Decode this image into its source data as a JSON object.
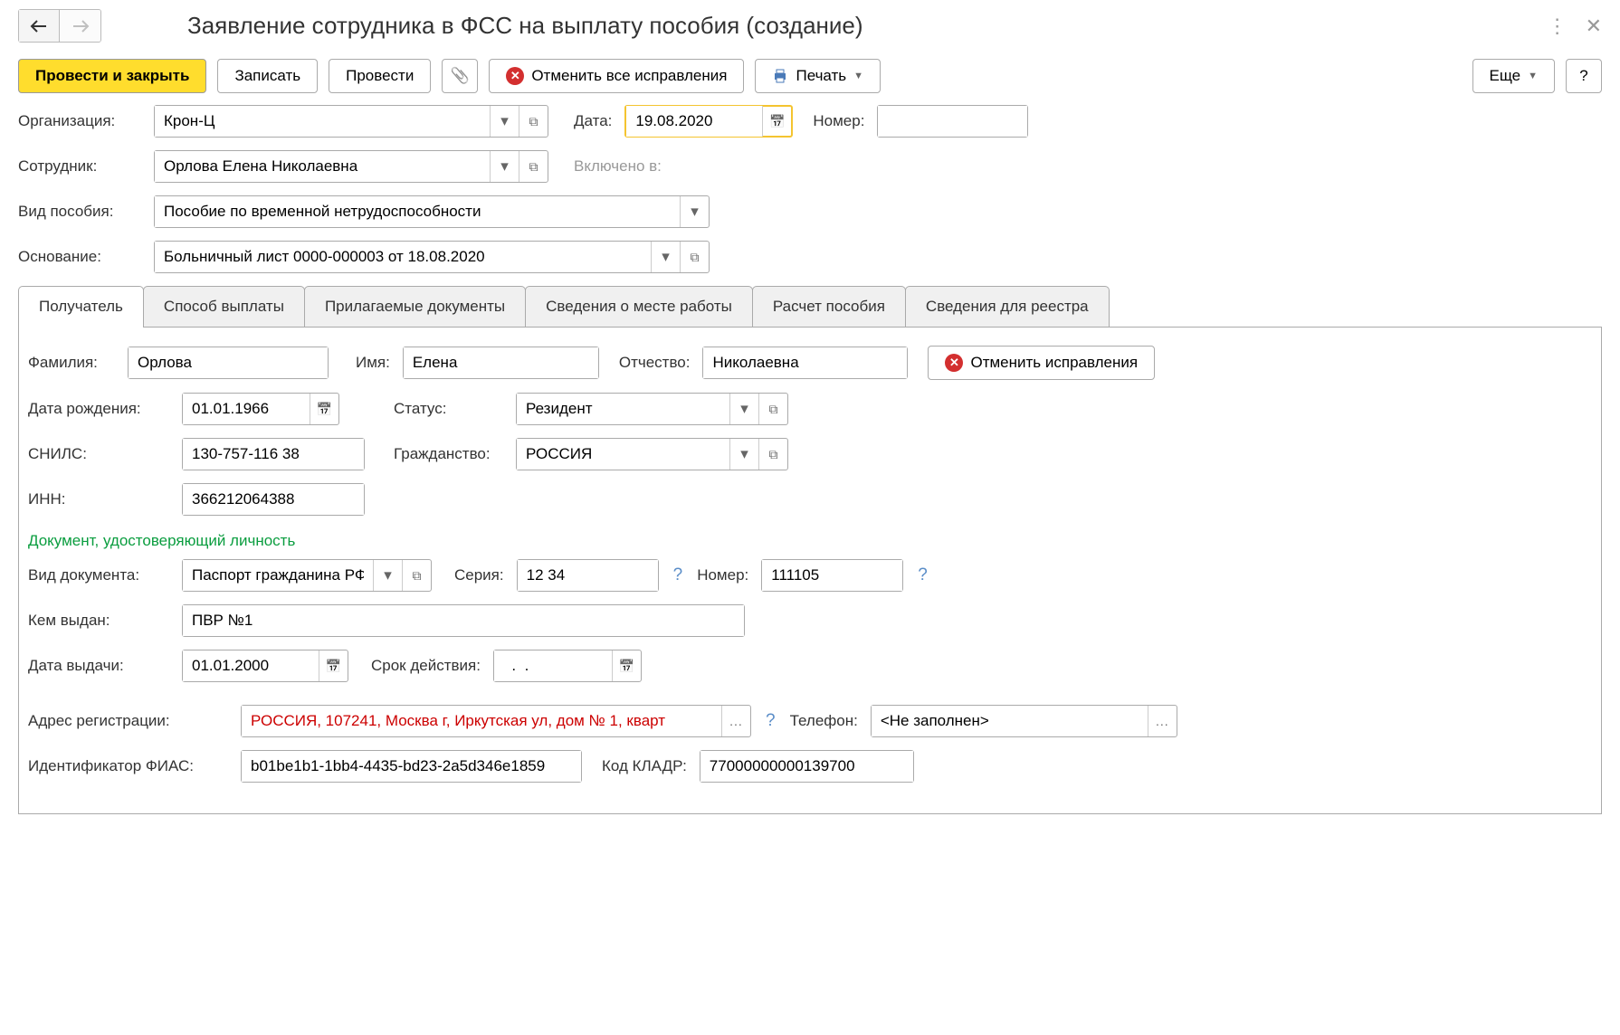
{
  "header": {
    "title": "Заявление сотрудника в ФСС на выплату пособия (создание)"
  },
  "toolbar": {
    "post_close": "Провести и закрыть",
    "save": "Записать",
    "post": "Провести",
    "cancel_all": "Отменить все исправления",
    "print": "Печать",
    "more": "Еще",
    "help": "?"
  },
  "main": {
    "org_label": "Организация:",
    "org_value": "Крон-Ц",
    "date_label": "Дата:",
    "date_value": "19.08.2020",
    "number_label": "Номер:",
    "number_value": "",
    "employee_label": "Сотрудник:",
    "employee_value": "Орлова Елена Николаевна",
    "included_label": "Включено в:",
    "benefit_type_label": "Вид пособия:",
    "benefit_type_value": "Пособие по временной нетрудоспособности",
    "basis_label": "Основание:",
    "basis_value": "Больничный лист 0000-000003 от 18.08.2020"
  },
  "tabs": {
    "t1": "Получатель",
    "t2": "Способ выплаты",
    "t3": "Прилагаемые документы",
    "t4": "Сведения о месте работы",
    "t5": "Расчет пособия",
    "t6": "Сведения для реестра"
  },
  "recipient": {
    "surname_label": "Фамилия:",
    "surname": "Орлова",
    "name_label": "Имя:",
    "name": "Елена",
    "patronymic_label": "Отчество:",
    "patronymic": "Николаевна",
    "cancel_fix": "Отменить исправления",
    "dob_label": "Дата рождения:",
    "dob": "01.01.1966",
    "status_label": "Статус:",
    "status": "Резидент",
    "snils_label": "СНИЛС:",
    "snils": "130-757-116 38",
    "citizenship_label": "Гражданство:",
    "citizenship": "РОССИЯ",
    "inn_label": "ИНН:",
    "inn": "366212064388",
    "id_section": "Документ, удостоверяющий личность",
    "doc_type_label": "Вид документа:",
    "doc_type": "Паспорт гражданина РФ",
    "series_label": "Серия:",
    "series": "12 34",
    "num_label": "Номер:",
    "num": "111105",
    "issued_by_label": "Кем выдан:",
    "issued_by": "ПВР №1",
    "issue_date_label": "Дата выдачи:",
    "issue_date": "01.01.2000",
    "expiry_label": "Срок действия:",
    "expiry": "  .  .",
    "address_label": "Адрес регистрации:",
    "address": "РОССИЯ, 107241, Москва г, Иркутская ул, дом № 1, кварт",
    "phone_label": "Телефон:",
    "phone": "<Не заполнен>",
    "fias_label": "Идентификатор ФИАС:",
    "fias": "b01be1b1-1bb4-4435-bd23-2a5d346e1859",
    "kladr_label": "Код КЛАДР:",
    "kladr": "77000000000139700"
  }
}
